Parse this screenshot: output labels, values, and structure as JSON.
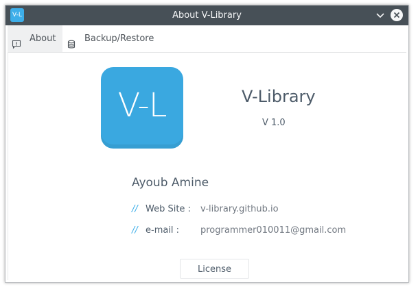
{
  "window": {
    "title": "About V-Library",
    "app_icon_text": "V-L",
    "titlebar_color": "#475057"
  },
  "tabs": [
    {
      "label": "About",
      "icon": "info-icon",
      "active": true
    },
    {
      "label": "Backup/Restore",
      "icon": "database-icon",
      "active": false
    }
  ],
  "about": {
    "logo_text": "V-L",
    "logo_color": "#3aa8e0",
    "app_name": "V-Library",
    "version": "V 1.0",
    "author": "Ayoub Amine",
    "website_label": "Web Site :",
    "website_value": "v-library.github.io",
    "email_label": "e-mail :",
    "email_value": "programmer010011@gmail.com",
    "row_marker": "//",
    "license_button": "License"
  },
  "accent_color": "#3daee9"
}
